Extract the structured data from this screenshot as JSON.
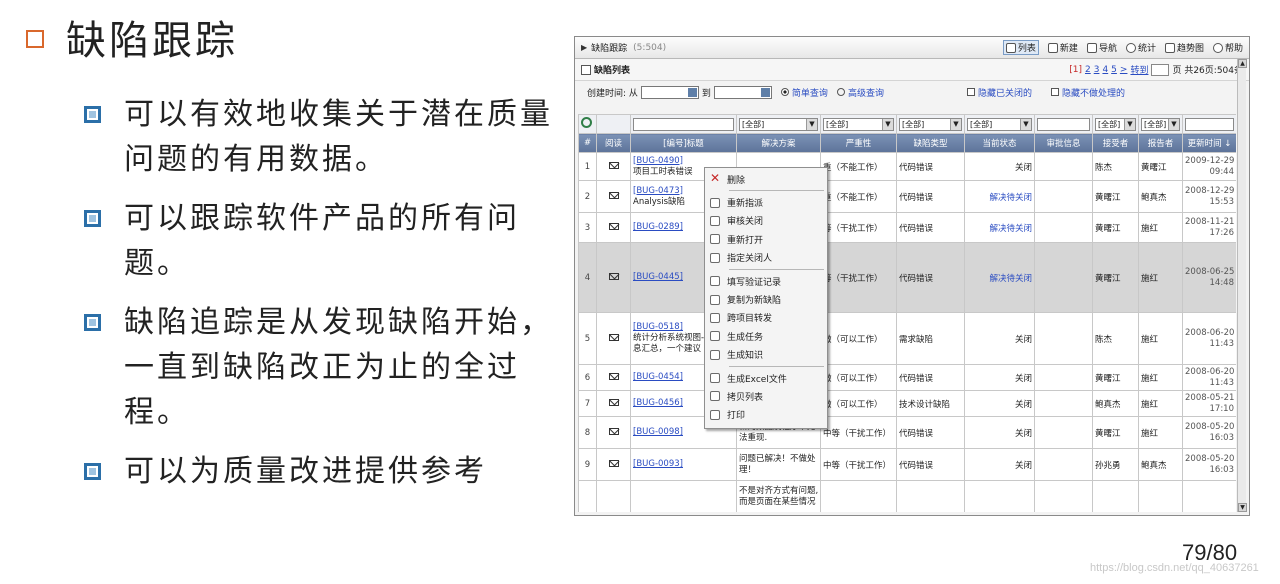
{
  "slide": {
    "title": "缺陷跟踪",
    "points": [
      "可以有效地收集关于潜在质量问题的有用数据。",
      "可以跟踪软件产品的所有问题。",
      "缺陷追踪是从发现缺陷开始，一直到缺陷改正为止的全过程。",
      "可以为质量改进提供参考"
    ],
    "page_number": "79/80",
    "watermark": "https://blog.csdn.net/qq_40637261",
    "colors": {
      "title_bullet": "#d9682c",
      "point_bullet": "#2b6fa8"
    }
  },
  "screenshot": {
    "topbar": {
      "title": "缺陷跟踪",
      "count": "(5:504)",
      "actions": [
        {
          "label": "列表",
          "icon": "list-icon"
        },
        {
          "label": "新建",
          "icon": "new-icon"
        },
        {
          "label": "导航",
          "icon": "navigate-icon"
        },
        {
          "label": "统计",
          "icon": "stats-icon"
        },
        {
          "label": "趋势图",
          "icon": "trend-icon"
        },
        {
          "label": "帮助",
          "icon": "help-icon"
        }
      ]
    },
    "list_title": "缺陷列表",
    "pager": {
      "current": "[1]",
      "pages": [
        "2",
        "3",
        "4",
        "5",
        ">"
      ],
      "goto": "转到",
      "suffix": "页 共26页:504条"
    },
    "filter": {
      "created_label": "创建时间: 从",
      "to_label": "到",
      "simple": "简单查询",
      "advanced": "高级查询",
      "hide_closed": "隐藏已关闭的",
      "hide_unhandled": "隐藏不做处理的"
    },
    "search_row": [
      "",
      "",
      "",
      "[全部]",
      "[全部]",
      "[全部]",
      "[全部]",
      "",
      "[全部]",
      "[全部]",
      ""
    ],
    "columns": [
      "#",
      "阅读",
      "[编号]标题",
      "解决方案",
      "严重性",
      "缺陷类型",
      "当前状态",
      "审批信息",
      "接受者",
      "报告者",
      "更新时间 ↓"
    ],
    "rows": [
      {
        "num": "1",
        "id": "[BUG-0490]",
        "title": "项目工时表错误",
        "solution": "",
        "severity": "重（不能工作）",
        "type": "代码错误",
        "state": "关闭",
        "approval": "",
        "assignee": "陈杰",
        "reporter": "黄曙江",
        "date": "2009-12-29",
        "time": "09:44"
      },
      {
        "num": "2",
        "id": "[BUG-0473]",
        "title": "Analysis缺陷",
        "solution": "",
        "severity": "重（不能工作）",
        "type": "代码错误",
        "state": "解决待关闭",
        "approval": "",
        "assignee": "黄曙江",
        "reporter": "鲍真杰",
        "date": "2008-12-29",
        "time": "15:53"
      },
      {
        "num": "3",
        "id": "[BUG-0289]",
        "title": "",
        "solution": "",
        "severity": "等（干扰工作）",
        "type": "代码错误",
        "state": "解决待关闭",
        "approval": "",
        "assignee": "黄曙江",
        "reporter": "施红",
        "date": "2008-11-21",
        "time": "17:26"
      },
      {
        "num": "4",
        "id": "[BUG-0445]",
        "title": "",
        "solution": "",
        "severity": "等（干扰工作）",
        "type": "代码错误",
        "state": "解决待关闭",
        "approval": "",
        "assignee": "黄曙江",
        "reporter": "施红",
        "date": "2008-06-25",
        "time": "14:48"
      },
      {
        "num": "5",
        "id": "[BUG-0518]",
        "title": "统计分析系统视图->",
        "title2": "息汇总，一个建议",
        "solution": "",
        "severity": "微（可以工作）",
        "type": "需求缺陷",
        "state": "关闭",
        "approval": "",
        "assignee": "陈杰",
        "reporter": "施红",
        "date": "2008-06-20",
        "time": "11:43"
      },
      {
        "num": "6",
        "id": "[BUG-0454]",
        "title": "",
        "solution": "",
        "severity": "微（可以工作）",
        "type": "代码错误",
        "state": "关闭",
        "approval": "",
        "assignee": "黄曙江",
        "reporter": "施红",
        "date": "2008-06-20",
        "time": "11:43"
      },
      {
        "num": "7",
        "id": "[BUG-0456]",
        "title": "",
        "solution": "",
        "severity": "微（可以工作）",
        "type": "技术设计缺陷",
        "state": "关闭",
        "approval": "",
        "assignee": "鲍真杰",
        "reporter": "施红",
        "date": "2008-05-21",
        "time": "17:10"
      },
      {
        "num": "8",
        "id": "[BUG-0098]",
        "title": "",
        "solution": "新的数据及程序下无",
        "solution2": "法重现.",
        "severity": "中等（干扰工作）",
        "type": "代码错误",
        "state": "关闭",
        "approval": "",
        "assignee": "黄曙江",
        "reporter": "施红",
        "date": "2008-05-20",
        "time": "16:03"
      },
      {
        "num": "9",
        "id": "[BUG-0093]",
        "title": "",
        "solution": "问题已解决！不做处",
        "solution2": "理！",
        "severity": "中等（干扰工作）",
        "type": "代码错误",
        "state": "关闭",
        "approval": "",
        "assignee": "孙兆勇",
        "reporter": "鲍真杰",
        "date": "2008-05-20",
        "time": "16:03"
      },
      {
        "num": "",
        "id": "",
        "title": "",
        "solution": "不是对齐方式有问题,",
        "solution2": "而是页面在某些情况",
        "severity": "",
        "type": "",
        "state": "",
        "approval": "",
        "assignee": "",
        "reporter": "",
        "date": "",
        "time": ""
      }
    ],
    "context_menu": {
      "groups": [
        [
          {
            "label": "删除",
            "icon": "delete-icon"
          }
        ],
        [
          {
            "label": "重新指派",
            "icon": "reassign-icon"
          },
          {
            "label": "审核关闭",
            "icon": "approve-close-icon"
          },
          {
            "label": "重新打开",
            "icon": "reopen-icon"
          },
          {
            "label": "指定关闭人",
            "icon": "assign-closer-icon"
          }
        ],
        [
          {
            "label": "填写验证记录",
            "icon": "verify-record-icon"
          },
          {
            "label": "复制为新缺陷",
            "icon": "copy-icon"
          },
          {
            "label": "跨项目转发",
            "icon": "forward-icon"
          },
          {
            "label": "生成任务",
            "icon": "task-icon"
          },
          {
            "label": "生成知识",
            "icon": "knowledge-icon"
          }
        ],
        [
          {
            "label": "生成Excel文件",
            "icon": "excel-icon"
          },
          {
            "label": "拷贝列表",
            "icon": "copy-list-icon"
          },
          {
            "label": "打印",
            "icon": "print-icon"
          }
        ]
      ]
    }
  }
}
